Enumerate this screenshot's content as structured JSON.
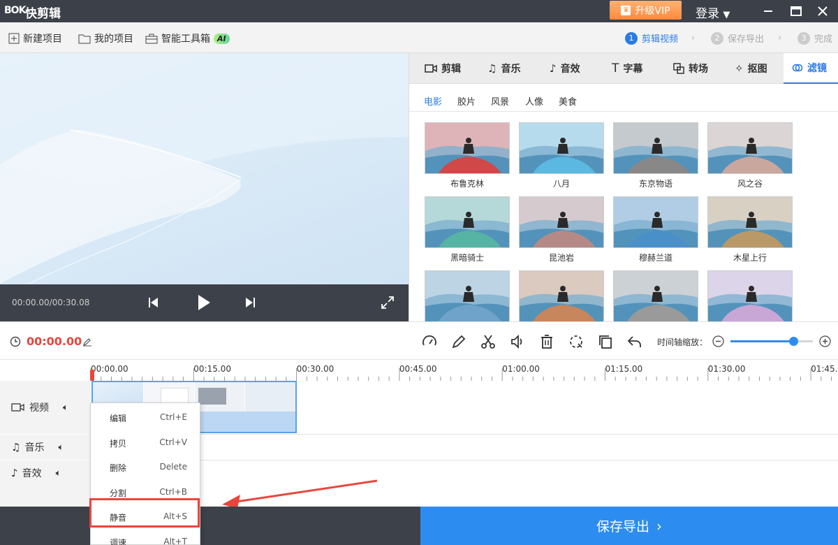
{
  "app": {
    "logo": "BOK",
    "title": "快剪辑",
    "vip_label": "升级VIP",
    "login_label": "登录"
  },
  "menubar": {
    "items": [
      {
        "label": "新建项目",
        "icon": "new-project-icon"
      },
      {
        "label": "我的项目",
        "icon": "folder-icon"
      },
      {
        "label": "智能工具箱",
        "icon": "toolbox-icon",
        "badge": "AI"
      }
    ],
    "steps": [
      {
        "num": "1",
        "label": "剪辑视频",
        "active": true
      },
      {
        "num": "2",
        "label": "保存导出",
        "active": false
      },
      {
        "num": "3",
        "label": "完成",
        "active": false
      }
    ]
  },
  "preview": {
    "time": "00:00.00/00:30.08"
  },
  "panel": {
    "tabs": [
      {
        "label": "剪辑",
        "icon": "video-camera-icon"
      },
      {
        "label": "音乐",
        "icon": "music-note-icon"
      },
      {
        "label": "音效",
        "icon": "sound-effect-icon"
      },
      {
        "label": "字幕",
        "icon": "text-icon"
      },
      {
        "label": "转场",
        "icon": "transition-icon"
      },
      {
        "label": "抠图",
        "icon": "magic-wand-icon"
      },
      {
        "label": "滤镜",
        "icon": "filter-icon",
        "active": true
      }
    ],
    "subtabs": [
      "电影",
      "胶片",
      "风景",
      "人像",
      "美食"
    ],
    "active_subtab": "电影",
    "filters": [
      "布鲁克林",
      "八月",
      "东京物语",
      "风之谷",
      "黑暗骑士",
      "昆池岩",
      "穆赫兰道",
      "木星上行",
      "",
      "",
      "",
      ""
    ],
    "filter_tints": [
      "#d04848",
      "#5bb8e0",
      "#888888",
      "#c9a79f",
      "#57b3a3",
      "#b58a86",
      "#4a90c8",
      "#b99968",
      "#6fa3c9",
      "#c7865b",
      "#9a9a9a",
      "#c8a6d6"
    ]
  },
  "timeline": {
    "current_time": "00:00.00",
    "zoom_label": "时间轴缩放：",
    "zoom_level": 0.76,
    "ruler": [
      "00:00.00",
      "00:15.00",
      "00:30.00",
      "00:45.00",
      "01:00.00",
      "01:15.00",
      "01:30.00",
      "01:45.00"
    ],
    "tracks": [
      {
        "label": "视频",
        "icon": "video-camera-icon"
      },
      {
        "label": "音乐",
        "icon": "music-note-icon"
      },
      {
        "label": "音效",
        "icon": "sound-effect-icon"
      }
    ]
  },
  "context_menu": [
    {
      "label": "编辑",
      "shortcut": "Ctrl+E"
    },
    {
      "label": "拷贝",
      "shortcut": "Ctrl+V"
    },
    {
      "label": "删除",
      "shortcut": "Delete"
    },
    {
      "label": "分割",
      "shortcut": "Ctrl+B"
    },
    {
      "label": "静音",
      "shortcut": "Alt+S"
    },
    {
      "label": "调速",
      "shortcut": "Alt+T"
    }
  ],
  "export_label": "保存导出",
  "colors": {
    "accent": "#2c7be5",
    "time_red": "#e8463c",
    "dark": "#3d4149",
    "export_blue": "#2d8cf0",
    "vip_orange": "#ff8a3c"
  }
}
